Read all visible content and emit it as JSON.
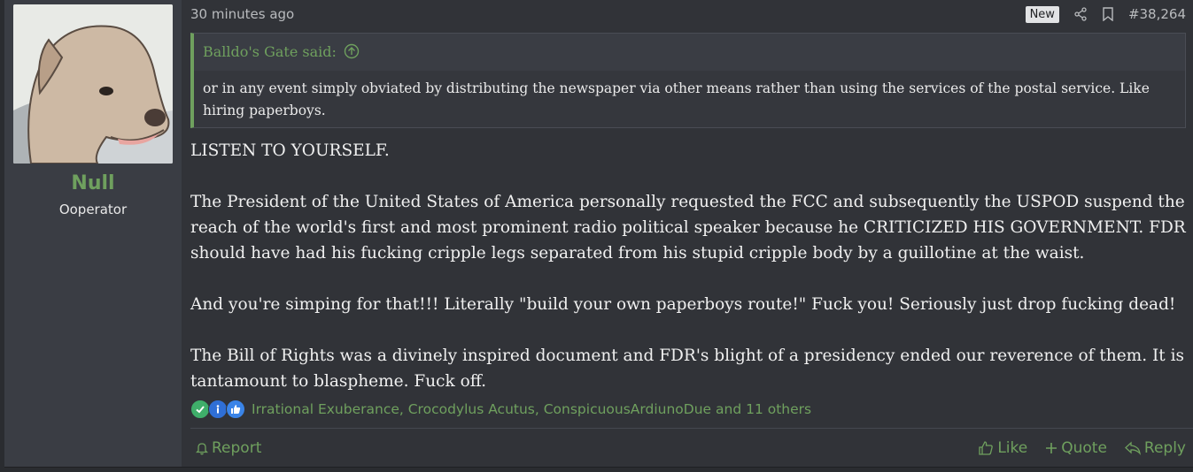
{
  "user": {
    "name": "Null",
    "title": "Ooperator"
  },
  "post": {
    "time": "30 minutes ago",
    "badge": "New",
    "number": "#38,264",
    "quote": {
      "author_line": "Balldo's Gate said:",
      "text": "or in any event simply obviated by distributing the newspaper via other means rather than using the services of the postal service. Like hiring paperboys."
    },
    "paragraphs": [
      "LISTEN TO YOURSELF.",
      "The President of the United States of America personally requested the FCC and subsequently the USPOD suspend the reach of the world's first and most prominent radio political speaker because he CRITICIZED HIS GOVERNMENT. FDR should have had his fucking cripple legs separated from his stupid cripple body by a guillotine at the waist.",
      "And you're simping for that!!! Literally \"build your own paperboys route!\" Fuck you! Seriously just drop fucking dead!",
      "The Bill of Rights was a divinely inspired document and FDR's blight of a presidency ended our reverence of them. It is tantamount to blaspheme. Fuck off."
    ],
    "reactions": {
      "icons": [
        "check-reaction-icon",
        "info-reaction-icon",
        "like-reaction-icon"
      ],
      "names": "Irrational Exuberance, Crocodylus Acutus, ConspicuousArdiunoDue and 11 others"
    }
  },
  "actions": {
    "report": "Report",
    "like": "Like",
    "quote": "Quote",
    "reply": "Reply"
  },
  "colors": {
    "accent": "#6fa05e",
    "background": "#313338",
    "sidebar": "#3a3d44"
  }
}
